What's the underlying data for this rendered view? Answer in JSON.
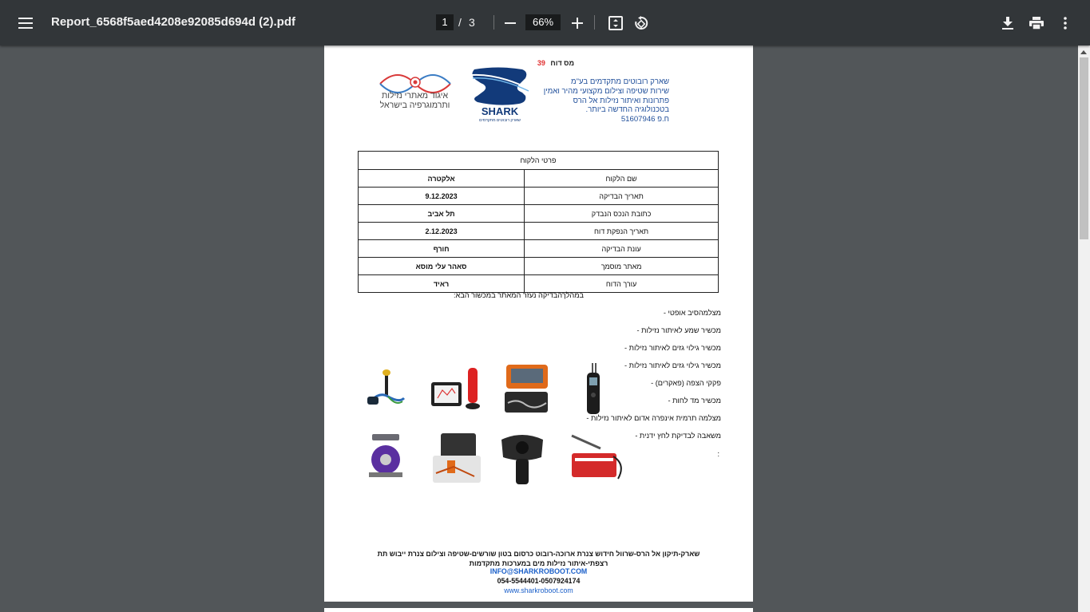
{
  "toolbar": {
    "title": "Report_6568f5aed4208e92085d694d (2).pdf",
    "current_page": "1",
    "page_separator": "/",
    "total_pages": "3",
    "zoom": "66%"
  },
  "report": {
    "number_label": "מס דוח",
    "number_value": "39",
    "company_lines": [
      "שארק רובוטים מתקדמים בע\"מ",
      "שירות שטיפה וצילום מקצועי מהיר ואמין",
      "פתרונות ואיתור נזילות אל הרס",
      "בטכנולוגיה החדשה ביותר.",
      "ח.פ 51607946"
    ],
    "shark_logo_text": "SHARK",
    "shark_logo_sub": "שארק רובוטים מתקדמים",
    "association_lines": [
      "איגוד מאתרי נזילות",
      "ותרמוגרפיה בישראל"
    ],
    "table_title": "פרטי הלקוח",
    "rows": [
      {
        "label": "שם הלקוח",
        "value": "אלקטרה"
      },
      {
        "label": "תאריך הבדיקה",
        "value": "9.12.2023"
      },
      {
        "label": "כתובת הנכס הנבדק",
        "value": "תל אביב"
      },
      {
        "label": "תאריך הנפקת דוח",
        "value": "2.12.2023"
      },
      {
        "label": "עונת הבדיקה",
        "value": "חורף"
      },
      {
        "label": "מאתר מוסמך",
        "value": "סאהר עלי מוסא"
      },
      {
        "label": "עורך הדוח",
        "value": "ראיד"
      }
    ],
    "intro_text": "במהלךהבדיקה נעזר המאתר במכשור הבא:",
    "tools": [
      "מצלמהסיב אופטי  -",
      "מכשיר שמע לאיתור נזילות  -",
      "מכשיר גילוי גזים לאיתור נזילות  -",
      "מכשיר גילוי גזים לאיתור נזילות  -",
      "פקקי הצפה (פאקרים)  -",
      "מכשיר מד לחות  -",
      "מצלמה תרמית אינפרה אדום לאיתור נזילות  -",
      "משאבה לבדיקת לחץ ידנית  -"
    ],
    "colon": ":",
    "footer_line1": "שארק-תיקון אל הרס-שרוול חידוש צנרת ארוכה-רובוט כרסום בטון שורשים-שטיפה וצילום צנרת ייבוש תת",
    "footer_line2": "רצפתי-איתור נזילות מים במערכות מתקדמות",
    "footer_email": "INFO@SHARKROBOOT.COM",
    "footer_phone": "054-5544401-0507924174",
    "footer_web": "www.sharkroboot.com"
  },
  "colors": {
    "toolbar_bg": "#323639",
    "viewer_bg": "#525659",
    "company_text": "#1f4e9a",
    "report_number": "#e03030",
    "link_blue": "#1a5fc9"
  },
  "icons": [
    "menu-icon",
    "zoom-out-icon",
    "zoom-in-icon",
    "fit-page-icon",
    "rotate-icon",
    "download-icon",
    "print-icon",
    "more-vert-icon"
  ]
}
